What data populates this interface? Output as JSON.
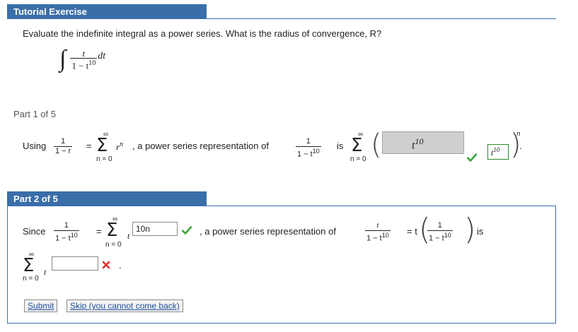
{
  "tutorial": {
    "title": "Tutorial Exercise"
  },
  "problem": {
    "prompt": "Evaluate the indefinite integral as a power series. What is the radius of convergence, R?",
    "integral_sign": "∫",
    "numerator": "t",
    "denominator_base": "1 − t",
    "denominator_exp": "10",
    "dt": "dt"
  },
  "part1": {
    "label": "Part 1 of 5",
    "using": "Using",
    "frac_num": "1",
    "frac_den": "1 − r",
    "equals": "=",
    "sum_top": "∞",
    "sum_sym": "Σ",
    "sum_bottom": "n = 0",
    "r_term": "r",
    "r_exp": "n",
    "phrase": ", a power series representation of",
    "frac2_num": "1",
    "frac2_den_base": "1 − t",
    "frac2_den_exp": "10",
    "is": "is",
    "answer_base": "t",
    "answer_exp": "10",
    "answer_display_base": "t",
    "answer_display_exp": "10",
    "outer_exp": "n",
    "period": "."
  },
  "part2": {
    "label": "Part 2 of 5",
    "since": "Since",
    "frac_num": "1",
    "frac_den_base": "1 − t",
    "frac_den_exp": "10",
    "equals": "=",
    "sum_top": "∞",
    "sum_sym": "Σ",
    "sum_bottom": "n = 0",
    "t_term": "t",
    "answer_value": "10n",
    "phrase": ", a power series representation of",
    "frac2_num": "t",
    "frac2_den_base": "1 − t",
    "frac2_den_exp": "10",
    "eq2": "= t",
    "frac3_num": "1",
    "frac3_den_base": "1 − t",
    "frac3_den_exp": "10",
    "is": "is",
    "sum2_top": "∞",
    "sum2_sym": "Σ",
    "sum2_bottom": "n = 0",
    "t2_term": "t",
    "answer2_value": "",
    "period": "."
  },
  "buttons": {
    "submit": "Submit",
    "skip": "Skip (you cannot come back)"
  },
  "colors": {
    "header": "#3a6ea8",
    "check": "#3aa535",
    "cross": "#e0322c"
  }
}
